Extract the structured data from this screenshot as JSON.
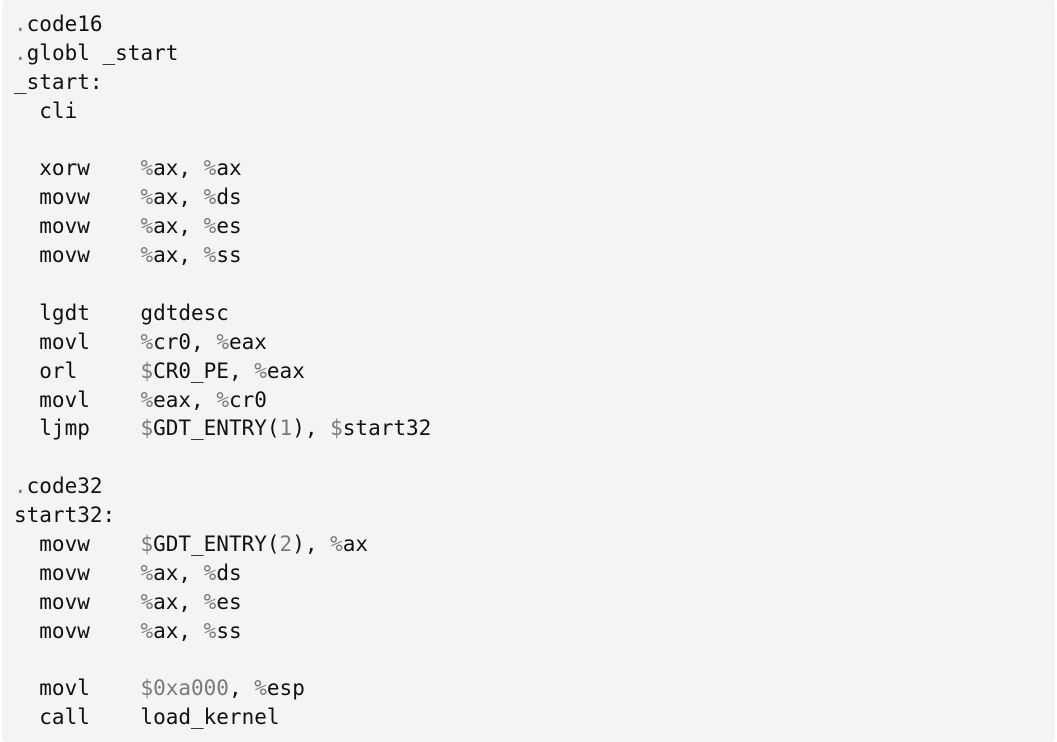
{
  "colors": {
    "background": "#f3f4f6",
    "text": "#111111",
    "punctuation": "#7a7a7a"
  },
  "lines": [
    [
      {
        "t": ".",
        "c": "dim"
      },
      {
        "t": "code16"
      }
    ],
    [
      {
        "t": ".",
        "c": "dim"
      },
      {
        "t": "globl _start"
      }
    ],
    [
      {
        "t": "_start:"
      }
    ],
    [
      {
        "t": "  cli"
      }
    ],
    [],
    [
      {
        "t": "  xorw    "
      },
      {
        "t": "%",
        "c": "dim"
      },
      {
        "t": "ax, "
      },
      {
        "t": "%",
        "c": "dim"
      },
      {
        "t": "ax"
      }
    ],
    [
      {
        "t": "  movw    "
      },
      {
        "t": "%",
        "c": "dim"
      },
      {
        "t": "ax, "
      },
      {
        "t": "%",
        "c": "dim"
      },
      {
        "t": "ds"
      }
    ],
    [
      {
        "t": "  movw    "
      },
      {
        "t": "%",
        "c": "dim"
      },
      {
        "t": "ax, "
      },
      {
        "t": "%",
        "c": "dim"
      },
      {
        "t": "es"
      }
    ],
    [
      {
        "t": "  movw    "
      },
      {
        "t": "%",
        "c": "dim"
      },
      {
        "t": "ax, "
      },
      {
        "t": "%",
        "c": "dim"
      },
      {
        "t": "ss"
      }
    ],
    [],
    [
      {
        "t": "  lgdt    gdtdesc"
      }
    ],
    [
      {
        "t": "  movl    "
      },
      {
        "t": "%",
        "c": "dim"
      },
      {
        "t": "cr0, "
      },
      {
        "t": "%",
        "c": "dim"
      },
      {
        "t": "eax"
      }
    ],
    [
      {
        "t": "  orl     "
      },
      {
        "t": "$",
        "c": "dim"
      },
      {
        "t": "CR0_PE, "
      },
      {
        "t": "%",
        "c": "dim"
      },
      {
        "t": "eax"
      }
    ],
    [
      {
        "t": "  movl    "
      },
      {
        "t": "%",
        "c": "dim"
      },
      {
        "t": "eax, "
      },
      {
        "t": "%",
        "c": "dim"
      },
      {
        "t": "cr0"
      }
    ],
    [
      {
        "t": "  ljmp    "
      },
      {
        "t": "$",
        "c": "dim"
      },
      {
        "t": "GDT_ENTRY("
      },
      {
        "t": "1",
        "c": "dim"
      },
      {
        "t": "), "
      },
      {
        "t": "$",
        "c": "dim"
      },
      {
        "t": "start32"
      }
    ],
    [],
    [
      {
        "t": ".",
        "c": "dim"
      },
      {
        "t": "code32"
      }
    ],
    [
      {
        "t": "start32:"
      }
    ],
    [
      {
        "t": "  movw    "
      },
      {
        "t": "$",
        "c": "dim"
      },
      {
        "t": "GDT_ENTRY("
      },
      {
        "t": "2",
        "c": "dim"
      },
      {
        "t": "), "
      },
      {
        "t": "%",
        "c": "dim"
      },
      {
        "t": "ax"
      }
    ],
    [
      {
        "t": "  movw    "
      },
      {
        "t": "%",
        "c": "dim"
      },
      {
        "t": "ax, "
      },
      {
        "t": "%",
        "c": "dim"
      },
      {
        "t": "ds"
      }
    ],
    [
      {
        "t": "  movw    "
      },
      {
        "t": "%",
        "c": "dim"
      },
      {
        "t": "ax, "
      },
      {
        "t": "%",
        "c": "dim"
      },
      {
        "t": "es"
      }
    ],
    [
      {
        "t": "  movw    "
      },
      {
        "t": "%",
        "c": "dim"
      },
      {
        "t": "ax, "
      },
      {
        "t": "%",
        "c": "dim"
      },
      {
        "t": "ss"
      }
    ],
    [],
    [
      {
        "t": "  movl    "
      },
      {
        "t": "$0xa000",
        "c": "dim"
      },
      {
        "t": ", "
      },
      {
        "t": "%",
        "c": "dim"
      },
      {
        "t": "esp"
      }
    ],
    [
      {
        "t": "  call    load_kernel"
      }
    ]
  ]
}
